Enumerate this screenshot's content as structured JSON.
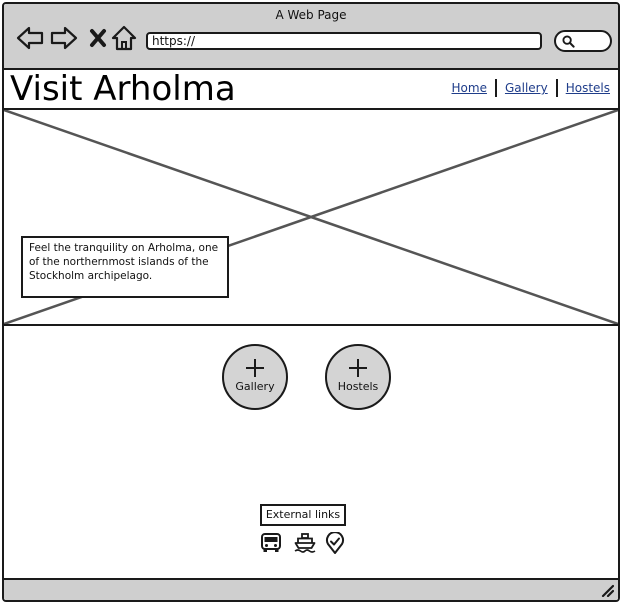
{
  "window": {
    "title": "A Web Page"
  },
  "toolbar": {
    "back_icon": "back-arrow-icon",
    "forward_icon": "forward-arrow-icon",
    "stop_icon": "close-icon",
    "home_icon": "home-icon",
    "url": "https://",
    "search_icon": "search-icon"
  },
  "header": {
    "title": "Visit Arholma",
    "nav": [
      {
        "label": "Home"
      },
      {
        "label": "Gallery"
      },
      {
        "label": "Hostels"
      }
    ]
  },
  "hero": {
    "image": "image-placeholder",
    "caption": "Feel the tranquility on Arholma, one of the northernmost islands of the Stockholm archipelago."
  },
  "actions": {
    "gallery_label": "Gallery",
    "hostels_label": "Hostels",
    "icon": "plus-icon"
  },
  "external": {
    "label": "External links",
    "icons": [
      "bus-icon",
      "ship-icon",
      "location-check-icon"
    ]
  },
  "colors": {
    "chrome": "#cfcfcf",
    "link": "#1f3d8a",
    "circle": "#d4d4d4",
    "stroke": "#1a1a1a"
  }
}
